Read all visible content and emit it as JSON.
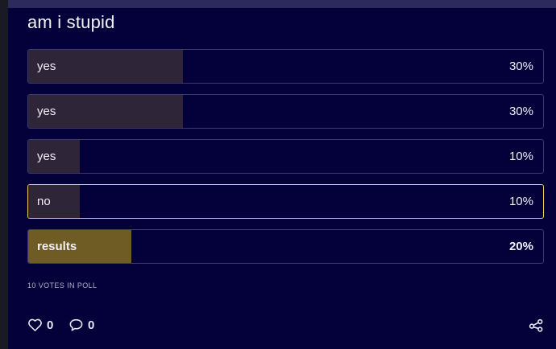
{
  "poll": {
    "title": "am i stupid",
    "options": [
      {
        "label": "yes",
        "percent_text": "30%",
        "percent": 30,
        "selected": false,
        "results": false
      },
      {
        "label": "yes",
        "percent_text": "30%",
        "percent": 30,
        "selected": false,
        "results": false
      },
      {
        "label": "yes",
        "percent_text": "10%",
        "percent": 10,
        "selected": false,
        "results": false
      },
      {
        "label": "no",
        "percent_text": "10%",
        "percent": 10,
        "selected": true,
        "results": false
      },
      {
        "label": "results",
        "percent_text": "20%",
        "percent": 20,
        "selected": false,
        "results": true
      }
    ],
    "votes_text": "10 VOTES IN POLL"
  },
  "footer": {
    "likes": "0",
    "comments": "0",
    "like_icon": "heart-icon",
    "comment_icon": "comment-icon",
    "share_icon": "share-icon"
  },
  "colors": {
    "background": "#03003a",
    "bar_fill": "#2e2638",
    "results_fill": "#6e5c24",
    "selected_border": "#e4cf5a",
    "text": "#f0f0f6"
  }
}
